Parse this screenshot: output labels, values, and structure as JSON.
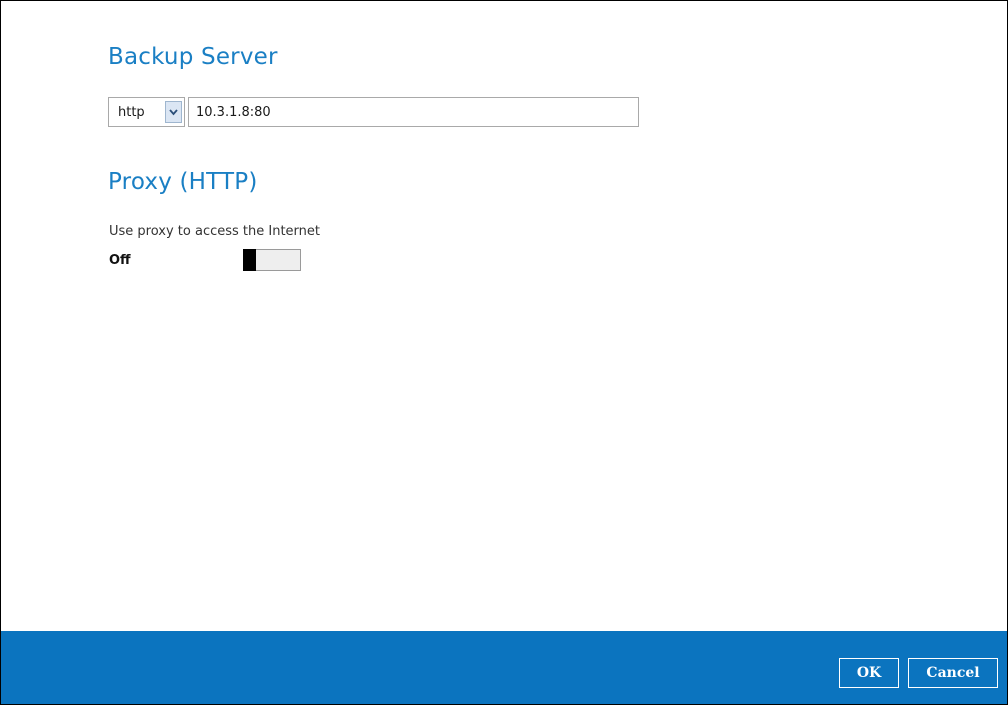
{
  "backup_server": {
    "title": "Backup Server",
    "protocol": {
      "selected": "http",
      "icon": "chevron-down-icon"
    },
    "address": "10.3.1.8:80"
  },
  "proxy": {
    "title": "Proxy (HTTP)",
    "label": "Use proxy to access the Internet",
    "state_text": "Off",
    "enabled": false
  },
  "footer": {
    "ok_label": "OK",
    "cancel_label": "Cancel"
  },
  "colors": {
    "accent": "#1a7fc4",
    "footer_bg": "#0b74bf",
    "toggle_knob": "#000000"
  }
}
